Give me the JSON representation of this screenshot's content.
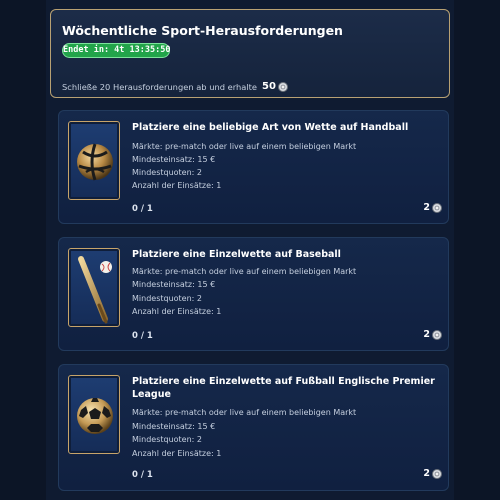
{
  "header": {
    "title": "Wöchentliche Sport-Herausforderungen",
    "timer": "Endet in: 4t 13:35:50",
    "description": "Schließe 20 Herausforderungen ab und erhalte",
    "points": "50",
    "points_icon": "chip-icon"
  },
  "challenges": [
    {
      "title": "Platziere eine beliebige Art von Wette auf Handball",
      "markets": "Märkte: pre-match oder live auf einem beliebigen Markt",
      "min_stake": "Mindesteinsatz: 15 €",
      "min_odds": "Mindestquoten: 2",
      "bet_count": "Anzahl der Einsätze: 1",
      "progress": "0 / 1",
      "reward": "2",
      "icon": "handball-icon"
    },
    {
      "title": "Platziere eine Einzelwette auf Baseball",
      "markets": "Märkte: pre-match oder live auf einem beliebigen Markt",
      "min_stake": "Mindesteinsatz: 15 €",
      "min_odds": "Mindestquoten: 2",
      "bet_count": "Anzahl der Einsätze: 1",
      "progress": "0 / 1",
      "reward": "2",
      "icon": "baseball-bat-icon"
    },
    {
      "title": "Platziere eine Einzelwette auf Fußball Englische Premier League",
      "markets": "Märkte: pre-match oder live auf einem beliebigen Markt",
      "min_stake": "Mindesteinsatz: 15 €",
      "min_odds": "Mindestquoten: 2",
      "bet_count": "Anzahl der Einsätze: 1",
      "progress": "0 / 1",
      "reward": "2",
      "icon": "soccer-ball-icon"
    }
  ],
  "colors": {
    "accent_gold": "#c7a46a",
    "timer_green": "#22a44a",
    "card_blue": "#15284a"
  }
}
